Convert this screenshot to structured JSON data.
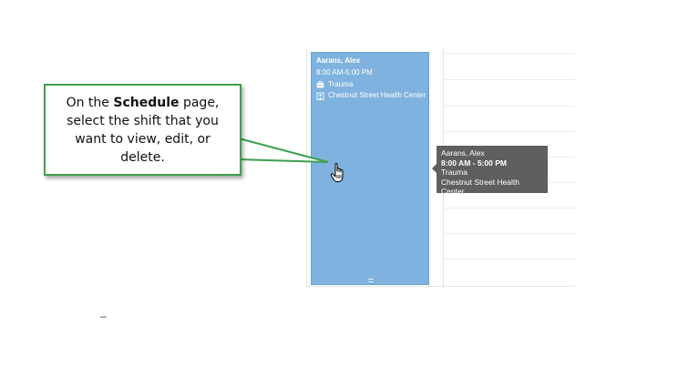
{
  "callout": {
    "prefix": "On the ",
    "emphasis": "Schedule",
    "suffix": " page, select the shift that you want to view, edit, or delete."
  },
  "shift": {
    "name": "Aarans, Alex",
    "time": "8:00 AM-5:00 PM",
    "department": "Trauma",
    "location": "Chestnut Street Health Center",
    "color": "#7fb2de",
    "department_icon": "briefcase-icon",
    "location_icon": "hospital-building-icon"
  },
  "tooltip": {
    "name": "Aarans, Alex",
    "time": "8:00 AM - 5:00 PM",
    "department": "Trauma",
    "location": "Chestnut Street Health Center"
  },
  "footer": {
    "mark": "–"
  },
  "colors": {
    "callout_border": "#3ea04f",
    "tooltip_bg": "#5f5f5f"
  }
}
